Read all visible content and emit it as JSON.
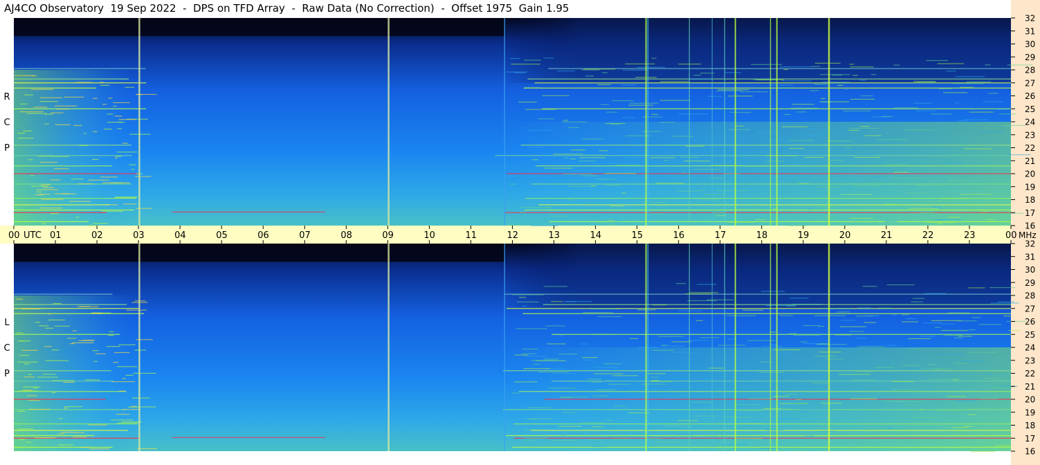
{
  "header": {
    "title": "AJ4CO Observatory  19 Sep 2022  -  DPS on TFD Array  -  Raw Data (No Correction)  -  Offset 1975  Gain 1.95"
  },
  "chart_data": {
    "type": "heatmap",
    "title": "AJ4CO Observatory  19 Sep 2022  -  DPS on TFD Array  -  Raw Data (No Correction)  -  Offset 1975  Gain 1.95",
    "x_axis": {
      "range_utc_hours": [
        0,
        24
      ],
      "ticks": [
        "00",
        "01",
        "02",
        "03",
        "04",
        "05",
        "06",
        "07",
        "08",
        "09",
        "10",
        "11",
        "12",
        "13",
        "14",
        "15",
        "16",
        "17",
        "18",
        "19",
        "20",
        "21",
        "22",
        "23",
        "00"
      ],
      "label": "UTC"
    },
    "y_axis": {
      "range_mhz": [
        16,
        32
      ],
      "ticks": [
        16,
        17,
        18,
        19,
        20,
        21,
        22,
        23,
        24,
        25,
        26,
        27,
        28,
        29,
        30,
        31,
        32
      ],
      "unit": "MHz"
    },
    "panels": [
      {
        "name": "RCP",
        "letters": [
          "R",
          "C",
          "P"
        ]
      },
      {
        "name": "LCP",
        "letters": [
          "L",
          "C",
          "P"
        ]
      }
    ],
    "colors": {
      "low": "#000010",
      "mid": "#1f6ff0",
      "high": "#b8ff30",
      "hot": "#ff2a4a"
    }
  }
}
